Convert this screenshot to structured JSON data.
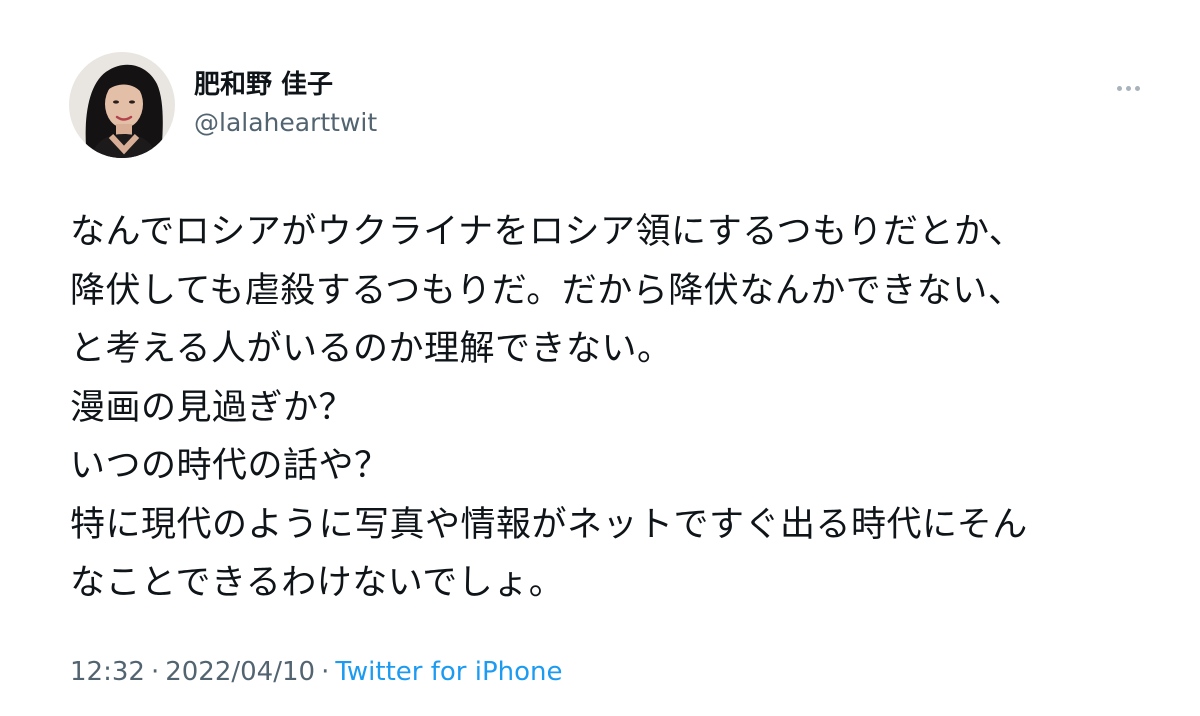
{
  "author": {
    "display_name": "肥和野 佳子",
    "handle": "@lalahearttwit"
  },
  "tweet": {
    "lines": [
      "なんでロシアがウクライナをロシア領にするつもりだとか、",
      "降伏しても虐殺するつもりだ。だから降伏なんかできない、",
      "と考える人がいるのか理解できない。",
      "漫画の見過ぎか？",
      "いつの時代の話や？",
      "特に現代のように写真や情報がネットですぐ出る時代にそん",
      "なことできるわけないでしょ。"
    ],
    "time": "12:32",
    "separator": "·",
    "date": "2022/04/10",
    "source": "Twitter for iPhone"
  },
  "icons": {
    "more": "more-horizontal-icon"
  },
  "colors": {
    "text": "#0f1419",
    "secondary": "#536471",
    "link": "#1d9bf0"
  }
}
